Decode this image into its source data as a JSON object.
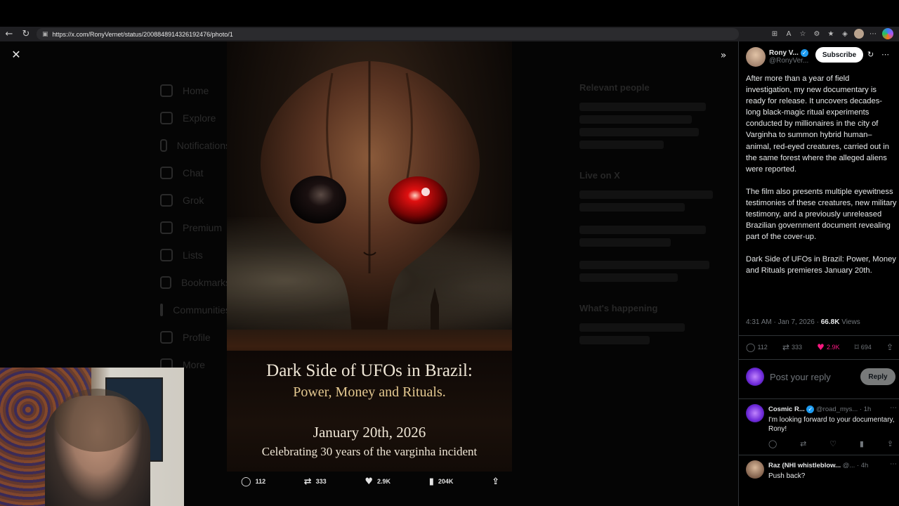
{
  "browser": {
    "url": "https://x.com/RonyVernet/status/2008848914326192476/photo/1"
  },
  "viewer": {
    "poster": {
      "title": "Dark Side of UFOs in Brazil:",
      "subtitle": "Power, Money and Rituals.",
      "date": "January 20th, 2026",
      "tagline": "Celebrating 30 years of the varginha incident"
    },
    "actions": {
      "replies": "112",
      "reposts": "333",
      "likes": "2.9K",
      "views": "204K"
    },
    "ghost_nav": [
      "Home",
      "Explore",
      "Notifications",
      "Chat",
      "Grok",
      "Premium",
      "Lists",
      "Bookmarks",
      "Communities",
      "Profile",
      "More"
    ],
    "ghost_right": {
      "relevant_people": "Relevant people",
      "live_on_x": "Live on X",
      "whats_happening": "What's happening"
    }
  },
  "panel": {
    "author_name": "Rony V...",
    "author_handle": "@RonyVer...",
    "subscribe": "Subscribe",
    "tweet_paragraphs": [
      "After more than a year of field investigation, my new documentary is ready for release. It uncovers decades-long black-magic ritual experiments conducted by millionaires in the city of Varginha to summon hybrid human–animal, red-eyed creatures, carried out in the same forest where the alleged aliens were reported.",
      "The film also presents multiple eyewitness testimonies of these creatures, new military testimony, and a previously unreleased Brazilian government document revealing part of the cover-up.",
      "Dark Side of UFOs in Brazil: Power, Money and Rituals premieres January 20th."
    ],
    "time": "4:31 AM · Jan 7, 2026 · ",
    "views_count": "66.8K",
    "views_label": " Views",
    "stats": {
      "replies": "112",
      "reposts": "333",
      "likes": "2.9K",
      "bookmarks": "694"
    },
    "reply_placeholder": "Post your reply",
    "reply_button": "Reply",
    "replies": [
      {
        "name": "Cosmic R...",
        "handle": " @road_mys...",
        "time": " · 1h",
        "text": "I'm looking forward to your documentary, Rony!"
      },
      {
        "name": "Raz (NHI whistleblow...",
        "handle": " @...",
        "time": " · 4h",
        "text": "Push back?"
      }
    ]
  },
  "colors": {
    "background": "#000000",
    "like_pink": "#f91880",
    "verified_blue": "#1d9bf0",
    "text_primary": "#e7e9ea",
    "text_secondary": "#71767b"
  }
}
